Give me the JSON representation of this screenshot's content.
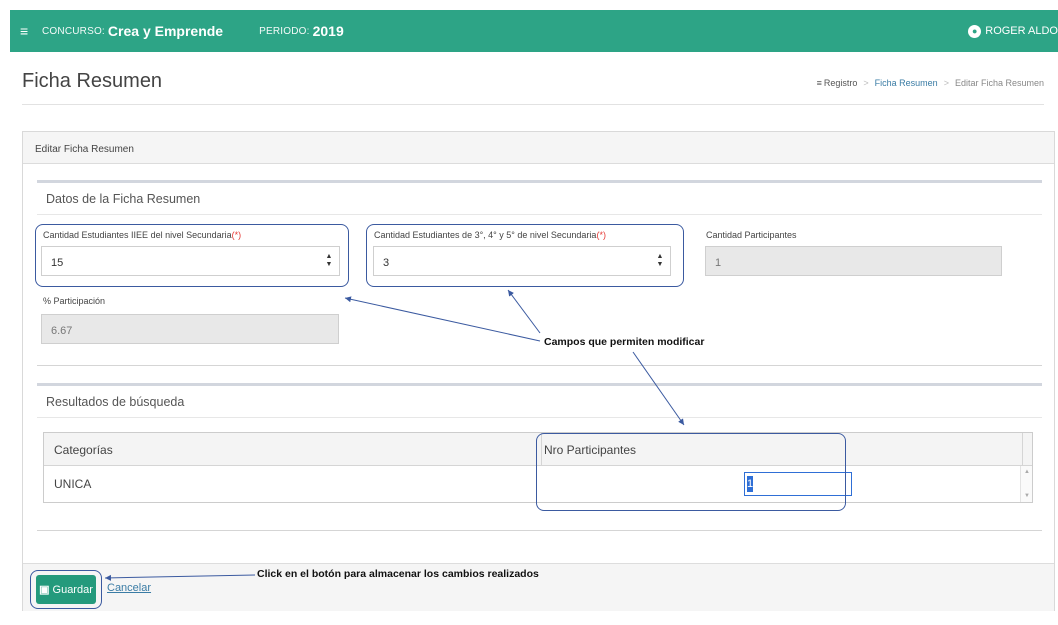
{
  "topbar": {
    "menu_icon": "hamburger-icon",
    "concurso_label": "CONCURSO:",
    "concurso_value": "Crea y Emprende",
    "periodo_label": "PERIODO:",
    "periodo_value": "2019",
    "user_icon": "user-circle-icon",
    "user_name": "ROGER ALDO",
    "accent_color": "#2da486"
  },
  "header": {
    "page_title": "Ficha Resumen",
    "breadcrumb": {
      "icon": "list-icon",
      "root": "Registro",
      "item2": "Ficha Resumen",
      "current": "Editar Ficha Resumen"
    }
  },
  "card": {
    "title": "Editar Ficha Resumen",
    "datos": {
      "title": "Datos de la Ficha Resumen",
      "cant_estudiantes_label": "Cantidad Estudiantes IIEE del nivel Secundaria",
      "cant_estudiantes_value": "15",
      "cant_3_4_5_label": "Cantidad Estudiantes de 3°, 4° y 5° de nivel Secundaria",
      "cant_3_4_5_value": "3",
      "cant_participantes_label": "Cantidad Participantes",
      "cant_participantes_value": "1",
      "participacion_label": "% Participación",
      "participacion_value": "6.67",
      "required_mark": "(*)"
    },
    "resultados": {
      "title": "Resultados de búsqueda",
      "columns": [
        "Categorías",
        "Nro Participantes"
      ],
      "rows": [
        {
          "categoria": "UNICA",
          "nro_participantes": "1"
        }
      ]
    },
    "footer": {
      "save_label": "Guardar",
      "cancel_label": "Cancelar"
    }
  },
  "annotations": {
    "editable_fields": "Campos que permiten modificar",
    "save_hint": "Click en el botón para almacenar los cambios realizados",
    "highlight_color": "#3b5aa0"
  }
}
